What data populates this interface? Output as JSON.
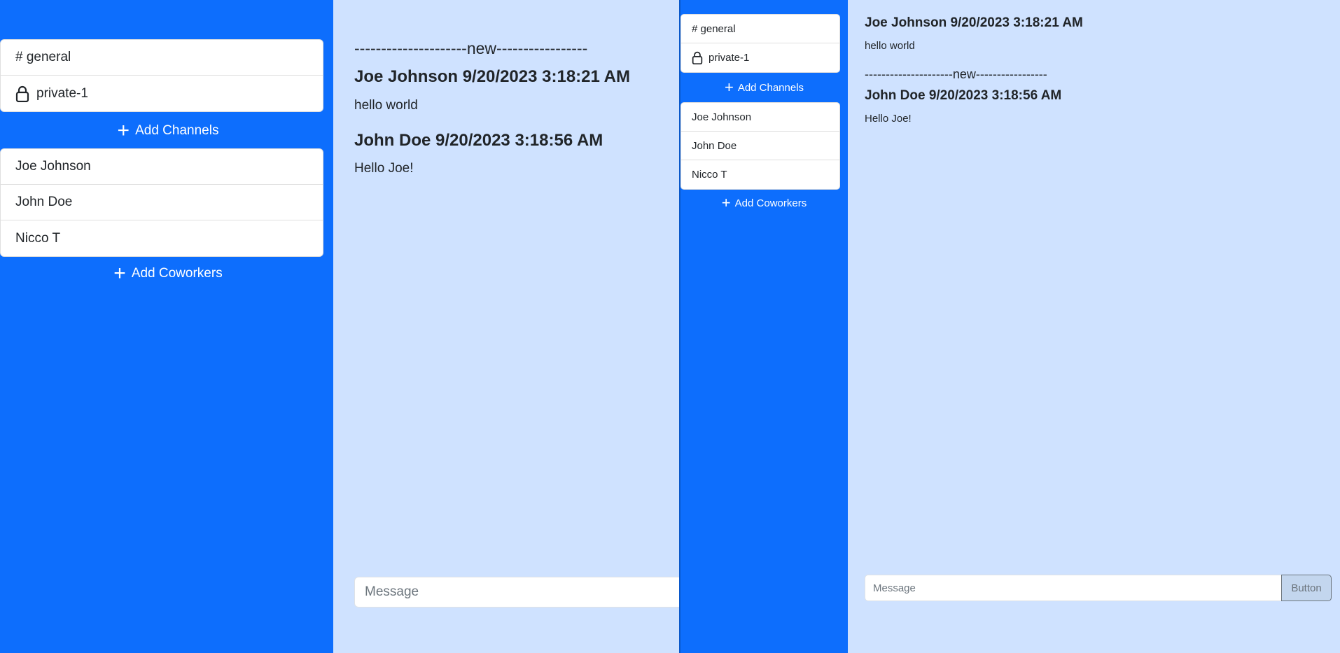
{
  "colors": {
    "sidebar_bg": "#0d6efd",
    "main_bg": "#cfe2ff"
  },
  "window_large": {
    "channels": [
      {
        "label": "# general",
        "icon": ""
      },
      {
        "label": "private-1",
        "icon": "lock-icon"
      }
    ],
    "add_channels_label": "Add Channels",
    "coworkers": [
      "Joe Johnson",
      "John Doe",
      "Nicco T"
    ],
    "add_coworkers_label": "Add Coworkers",
    "separator": "---------------------new-----------------",
    "messages": [
      {
        "header": "Joe Johnson 9/20/2023 3:18:21 AM",
        "text": "hello world"
      },
      {
        "header": "John Doe 9/20/2023 3:18:56 AM",
        "text": "Hello Joe!"
      }
    ],
    "input_placeholder": "Message"
  },
  "window_small": {
    "channels": [
      {
        "label": "# general",
        "icon": ""
      },
      {
        "label": "private-1",
        "icon": "lock-icon"
      }
    ],
    "add_channels_label": "Add Channels",
    "coworkers": [
      "Joe Johnson",
      "John Doe",
      "Nicco T"
    ],
    "add_coworkers_label": "Add Coworkers",
    "separator": "---------------------new-----------------",
    "messages": [
      {
        "header": "Joe Johnson 9/20/2023 3:18:21 AM",
        "text": "hello world"
      },
      {
        "header": "John Doe 9/20/2023 3:18:56 AM",
        "text": "Hello Joe!"
      }
    ],
    "input_placeholder": "Message",
    "button_label": "Button"
  }
}
